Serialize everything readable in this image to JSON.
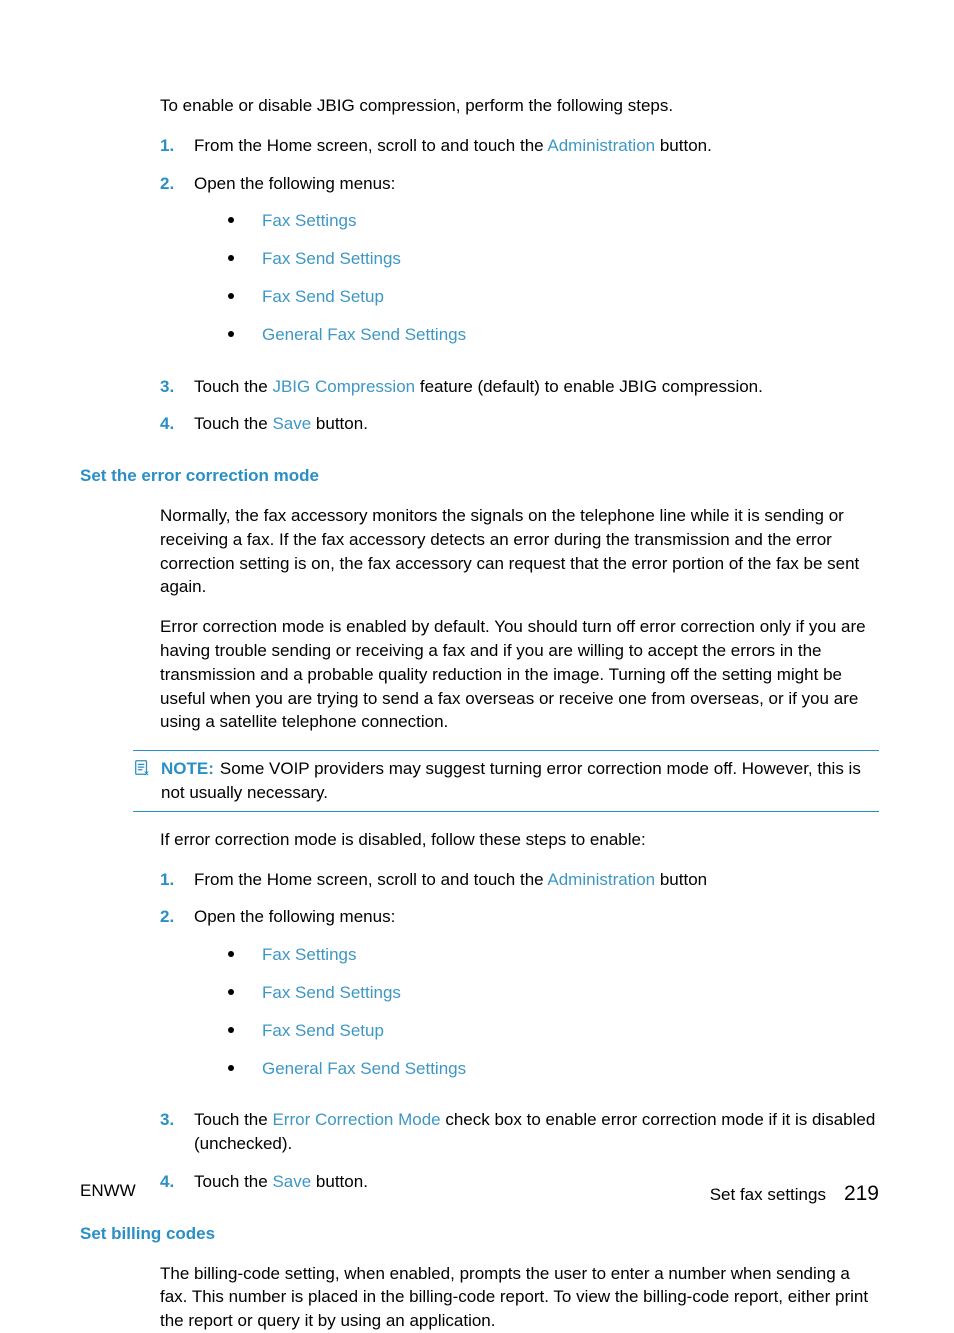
{
  "intro": {
    "lead_in": "To enable or disable JBIG compression, perform the following steps.",
    "steps": {
      "s1_a": "From the Home screen, scroll to and touch the ",
      "s1_ui": "Administration",
      "s1_b": " button.",
      "s2_a": "Open the following menus:",
      "s2_items": {
        "i1": "Fax Settings",
        "i2": "Fax Send Settings",
        "i3": "Fax Send Setup",
        "i4": "General Fax Send Settings"
      },
      "s3_a": "Touch the ",
      "s3_ui": "JBIG Compression",
      "s3_b": " feature (default) to enable JBIG compression.",
      "s4_a": "Touch the ",
      "s4_ui": "Save",
      "s4_b": " button."
    }
  },
  "sect1": {
    "heading": "Set the error correction mode",
    "p1": "Normally, the fax accessory monitors the signals on the telephone line while it is sending or receiving a fax. If the fax accessory detects an error during the transmission and the error correction setting is on, the fax accessory can request that the error portion of the fax be sent again.",
    "p2": "Error correction mode is enabled by default. You should turn off error correction only if you are having trouble sending or receiving a fax and if you are willing to accept the errors in the transmission and a probable quality reduction in the image. Turning off the setting might be useful when you are trying to send a fax overseas or receive one from overseas, or if you are using a satellite telephone connection.",
    "note_label": "NOTE:",
    "note_text": "Some VOIP providers may suggest turning error correction mode off. However, this is not usually necessary.",
    "p3": "If error correction mode is disabled, follow these steps to enable:",
    "steps": {
      "s1_a": "From the Home screen, scroll to and touch the ",
      "s1_ui": "Administration",
      "s1_b": " button",
      "s2_a": "Open the following menus:",
      "s2_items": {
        "i1": "Fax Settings",
        "i2": "Fax Send Settings",
        "i3": "Fax Send Setup",
        "i4": "General Fax Send Settings"
      },
      "s3_a": "Touch the ",
      "s3_ui": "Error Correction Mode",
      "s3_b": " check box to enable error correction mode if it is disabled (unchecked).",
      "s4_a": "Touch the ",
      "s4_ui": "Save",
      "s4_b": " button."
    }
  },
  "sect2": {
    "heading": "Set billing codes",
    "p1": "The billing-code setting, when enabled, prompts the user to enter a number when sending a fax. This number is placed in the billing-code report. To view the billing-code report, either print the report or query it by using an application."
  },
  "footer": {
    "left": "ENWW",
    "right_label": "Set fax settings",
    "page": "219"
  },
  "nums": {
    "n1": "1.",
    "n2": "2.",
    "n3": "3.",
    "n4": "4."
  }
}
